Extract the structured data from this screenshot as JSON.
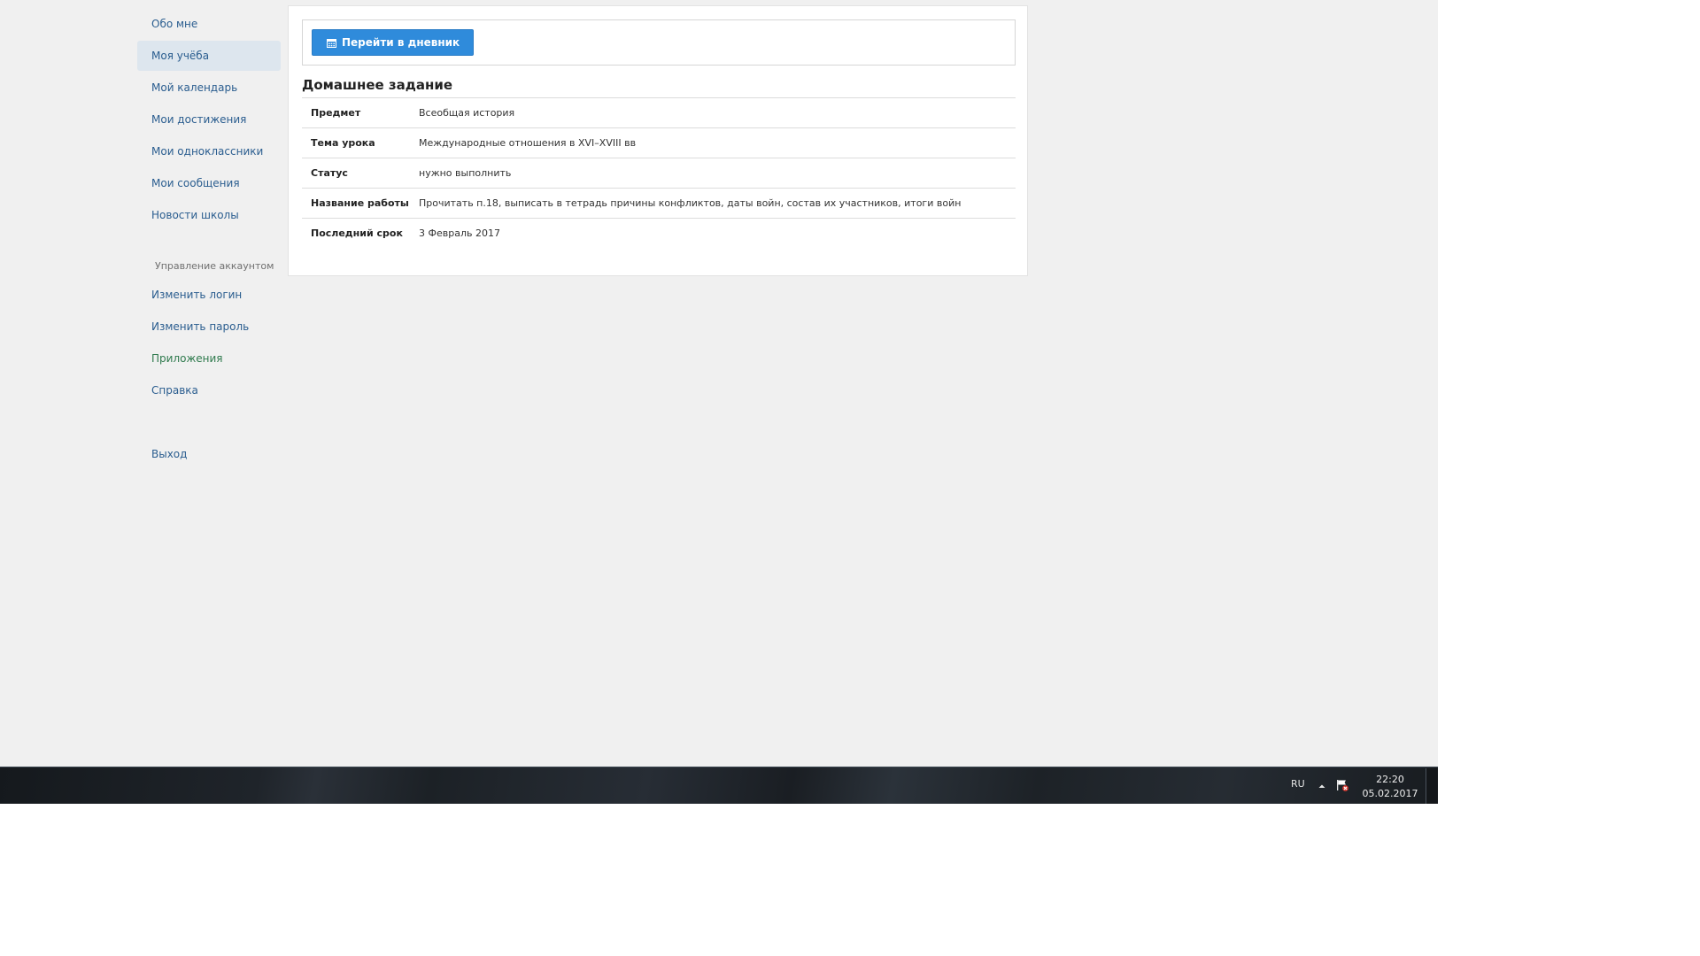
{
  "sidebar": {
    "items": [
      {
        "label": "Обо мне"
      },
      {
        "label": "Моя учёба"
      },
      {
        "label": "Мой календарь"
      },
      {
        "label": "Мои достижения"
      },
      {
        "label": "Мои одноклассники"
      },
      {
        "label": "Мои сообщения"
      },
      {
        "label": "Новости школы"
      }
    ],
    "account_title": "Управление аккаунтом",
    "account_items": [
      {
        "label": "Изменить логин"
      },
      {
        "label": "Изменить пароль"
      },
      {
        "label": "Приложения"
      },
      {
        "label": "Справка"
      }
    ],
    "logout_label": "Выход"
  },
  "main": {
    "diary_button_label": "Перейти в дневник",
    "section_title": "Домашнее задание",
    "rows": [
      {
        "label": "Предмет",
        "value": "Всеобщая история"
      },
      {
        "label": "Тема урока",
        "value": "Международные отношения в XVI–XVIII вв"
      },
      {
        "label": "Статус",
        "value": "нужно выполнить"
      },
      {
        "label": "Название работы",
        "value": "Прочитать п.18, выписать в тетрадь причины конфликтов, даты войн, состав их участников, итоги войн"
      },
      {
        "label": "Последний срок",
        "value": "3 Февраль 2017"
      }
    ]
  },
  "taskbar": {
    "language": "RU",
    "time": "22:20",
    "date": "05.02.2017"
  },
  "colors": {
    "link": "#2a5d8f",
    "active_bg": "#dde6ee",
    "primary_button": "#2f8bdb",
    "green_link": "#2f7a4d"
  },
  "icons": {
    "diary_button": "calendar-icon",
    "tray_expand": "chevron-up-icon",
    "tray_action_center": "flag-warning-icon"
  }
}
